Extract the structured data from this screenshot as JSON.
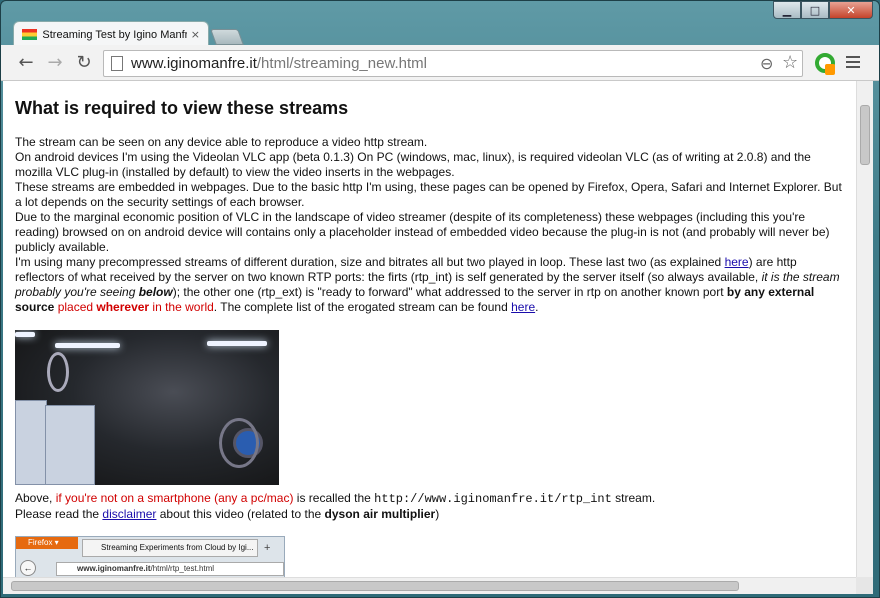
{
  "window": {
    "minimize_glyph": "▁",
    "maximize_glyph": "□",
    "close_glyph": "✕"
  },
  "tab": {
    "title": "Streaming Test by Igino Manfre",
    "close_glyph": "×"
  },
  "toolbar": {
    "back_glyph": "←",
    "forward_glyph": "→",
    "reload_glyph": "↻",
    "url_host": "www.iginomanfre.it",
    "url_path": "/html/streaming_new.html",
    "zoom_glyph": "⊖",
    "star_glyph": "☆"
  },
  "page": {
    "heading": "What is required to view these streams",
    "p1": "The stream can be seen on any device able to reproduce a video http stream.",
    "p2": "On android devices I'm using the Videolan VLC app (beta 0.1.3) On PC (windows, mac, linux), is required videolan VLC (as of writing at 2.0.8) and the mozilla VLC plug-in (installed by default) to view the video inserts in the webpages.",
    "p3": "These streams are embedded in webpages. Due to the basic http I'm using, these pages can be opened by Firefox, Opera, Safari and Internet Explorer. But a lot depends on the security settings of each browser.",
    "p4": "Due to the marginal economic position of VLC in the landscape of video streamer (despite of its completeness) these webpages (including this you're reading) browsed on on android device will contains only a placeholder instead of embedded video because the plug-in is not (and probably will never be) publicly available.",
    "p5_a": "I'm using many precompressed streams of different duration, size and bitrates all but two played in loop. These last two (as explained ",
    "p5_link1": "here",
    "p5_b": ") are http reflectors of what received by the server on two known RTP ports: the firts (rtp_int) is self generated by the server itself (so always available, ",
    "p5_ital": "it is the stream probably you're seeing ",
    "p5_ital_bold": "below",
    "p5_c": "); the other one (rtp_ext) is \"ready to forward\" what addressed to the server in rtp on another known port ",
    "p5_bold": "by any external source",
    "p5_red": " placed ",
    "p5_red_bold": "wherever",
    "p5_red2": " in the world",
    "p5_d": ". The complete list of the erogated stream can be found ",
    "p5_link2": "here",
    "p5_e": ".",
    "cap1_a": "Above, ",
    "cap1_red": "if you're not on a smartphone (any a pc/mac)",
    "cap1_b": " is recalled the ",
    "cap1_mono": "http://www.iginomanfre.it/rtp_int",
    "cap1_c": " stream.",
    "cap2_a": "Please read the ",
    "cap2_link": "disclaimer",
    "cap2_b": " about this video (related to the ",
    "cap2_bold": "dyson air multiplier",
    "cap2_c": ")"
  },
  "screenshot_thumb": {
    "firefox_label": "Firefox ▾",
    "tab_title": "Streaming Experiments from Cloud by Igi...",
    "plus_glyph": "+",
    "url_host": "www.iginomanfre.it",
    "url_path": "/html/rtp_test.html",
    "back_glyph": "←"
  }
}
